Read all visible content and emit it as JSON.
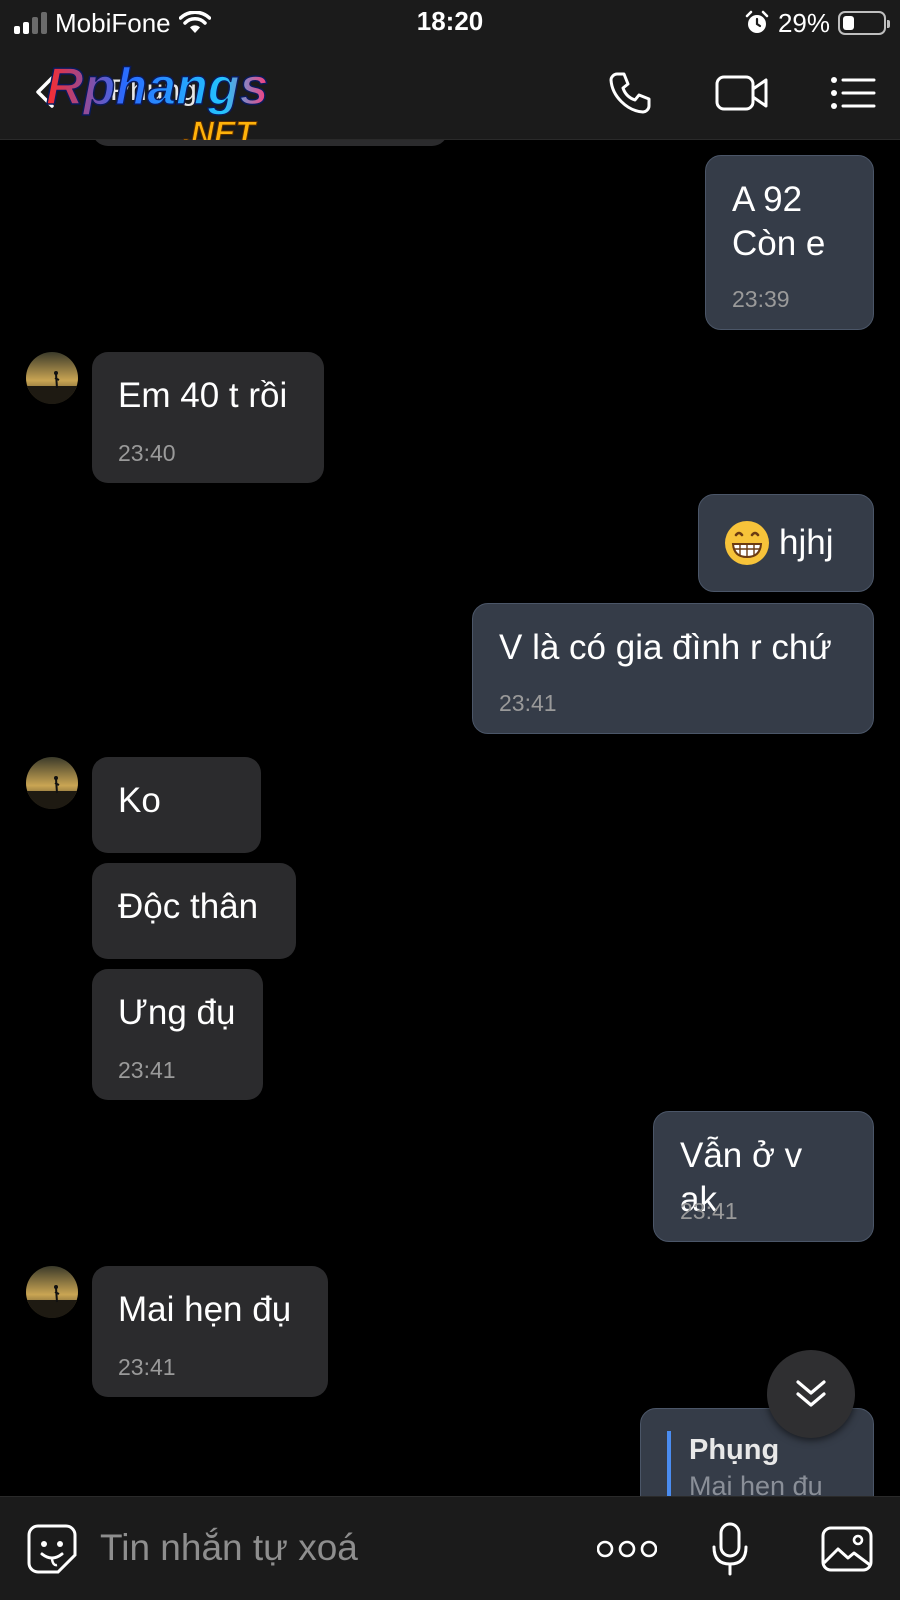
{
  "status_bar": {
    "carrier": "MobiFone",
    "time": "18:20",
    "battery": "29%",
    "battery_level": 0.29
  },
  "header": {
    "contact_name": "Phụng",
    "watermark_main": "Rphangs",
    "watermark_sub": ".NET",
    "icons": [
      "back-icon",
      "phone-icon",
      "video-call-icon",
      "menu-list-icon"
    ]
  },
  "messages": [
    {
      "side": "out",
      "lines": [
        "A 92",
        "Còn e"
      ],
      "time": "23:39"
    },
    {
      "side": "in",
      "lines": [
        "Em 40 t rồi"
      ],
      "time": "23:40"
    },
    {
      "side": "out",
      "emoji": "grinning-face-icon",
      "lines": [
        "hjhj"
      ],
      "time": ""
    },
    {
      "side": "out",
      "lines": [
        "V là có gia đình r chứ"
      ],
      "time": "23:41"
    },
    {
      "side": "in",
      "lines": [
        "Ko"
      ],
      "time": ""
    },
    {
      "side": "in",
      "lines": [
        "Độc thân"
      ],
      "time": ""
    },
    {
      "side": "in",
      "lines": [
        "Ưng đụ"
      ],
      "time": "23:41"
    },
    {
      "side": "out",
      "lines": [
        "Vẫn ở v ak"
      ],
      "time": "23:41"
    },
    {
      "side": "in",
      "lines": [
        "Mai hẹn đụ"
      ],
      "time": "23:41"
    },
    {
      "side": "out",
      "reply_name": "Phụng",
      "reply_text": "Mai hẹn đụ",
      "lines": [],
      "time": ""
    }
  ],
  "input_bar": {
    "placeholder": "Tin nhắn tự xoá",
    "icons": [
      "sticker-icon",
      "more-icon",
      "microphone-icon",
      "image-icon"
    ]
  },
  "colors": {
    "background": "#000000",
    "bar": "#1b1b1b",
    "bubble_in": "#2b2b2d",
    "bubble_out": "#353c48",
    "reply_accent": "#4a8cf0",
    "muted": "#9a9a9a"
  }
}
